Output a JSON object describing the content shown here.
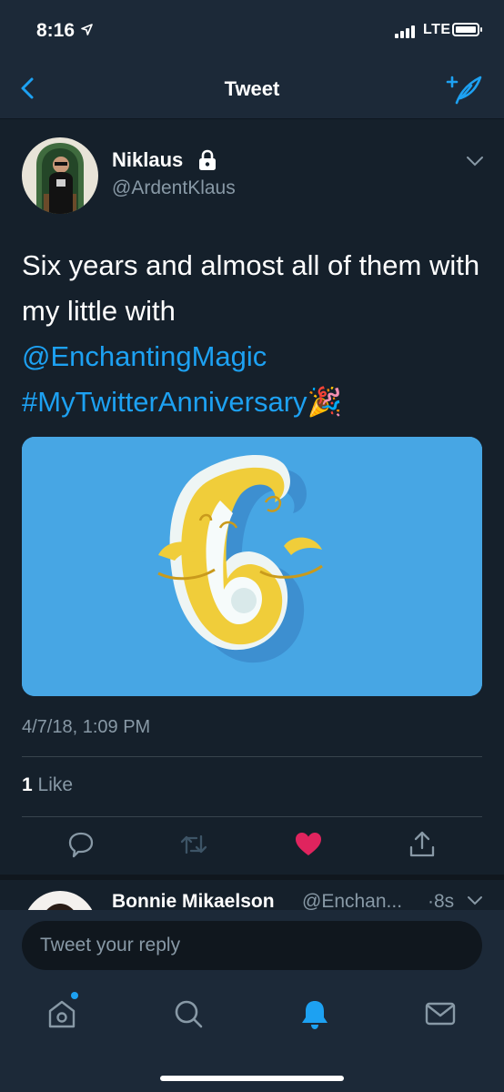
{
  "status_bar": {
    "time": "8:16",
    "network": "LTE"
  },
  "nav": {
    "title": "Tweet",
    "back_icon": "chevron-left-icon",
    "compose_icon": "compose-tweet-icon"
  },
  "tweet": {
    "author": {
      "display_name": "Niklaus",
      "handle": "@ArdentKlaus",
      "protected": true
    },
    "text_plain": "Six years and almost all of them with my little with",
    "mention": "@EnchantingMagic",
    "hashtag": "#MyTwitterAnniversary",
    "emoji": "🎉",
    "timestamp": "4/7/18, 1:09 PM",
    "like_count": "1",
    "like_label": "Like",
    "liked": true,
    "actions": [
      "reply-icon",
      "retweet-icon",
      "like-heart-icon",
      "share-icon"
    ]
  },
  "reply_preview": {
    "display_name": "Bonnie Mikaelson",
    "handle": "@Enchan...",
    "time": "8s"
  },
  "composer": {
    "placeholder": "Tweet your reply"
  },
  "tab_bar": {
    "tabs": [
      "home-icon",
      "search-icon",
      "notifications-bell-icon",
      "messages-envelope-icon"
    ],
    "active": "notifications-bell-icon"
  },
  "colors": {
    "background": "#15202b",
    "bar": "#1c2938",
    "accent": "#1da1f2",
    "like": "#e0245e",
    "secondary_text": "#8899a6"
  }
}
